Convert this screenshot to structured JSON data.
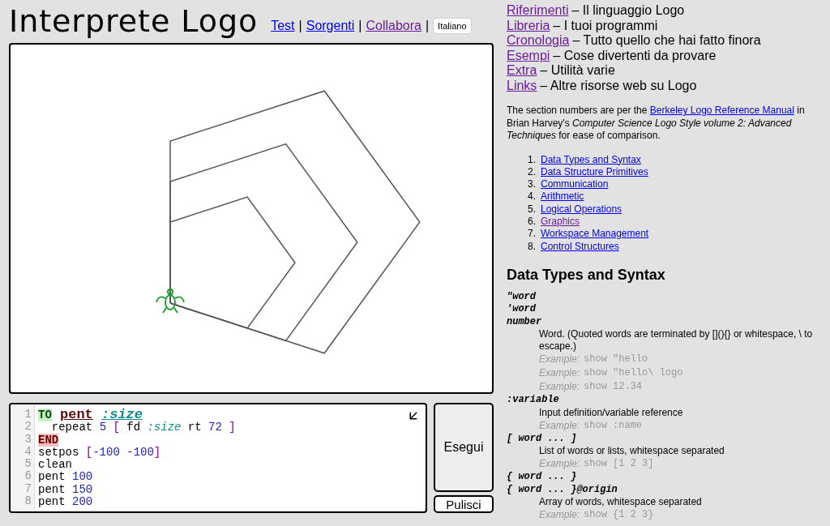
{
  "header": {
    "title": "Interprete Logo",
    "nav": [
      {
        "label": "Test",
        "visited": false,
        "separator": "|"
      },
      {
        "label": "Sorgenti",
        "visited": false,
        "separator": "|"
      },
      {
        "label": "Collabora",
        "visited": true,
        "separator": "|"
      }
    ],
    "language": "Italiano"
  },
  "editor": {
    "lines": [
      {
        "number": "1",
        "tokens": [
          {
            "text": "TO",
            "kind": "to"
          },
          {
            "text": "pent",
            "kind": "procname"
          },
          {
            "text": ":size",
            "kind": "param"
          }
        ]
      },
      {
        "number": "2",
        "tokens": [
          {
            "text": "  repeat ",
            "kind": "plain"
          },
          {
            "text": "5",
            "kind": "number"
          },
          {
            "text": " [",
            "kind": "bracket"
          },
          {
            "text": " fd ",
            "kind": "plain"
          },
          {
            "text": ":size",
            "kind": "var"
          },
          {
            "text": " rt ",
            "kind": "plain"
          },
          {
            "text": "72",
            "kind": "number"
          },
          {
            "text": " ]",
            "kind": "bracket"
          }
        ]
      },
      {
        "number": "3",
        "tokens": [
          {
            "text": "END",
            "kind": "end"
          }
        ]
      },
      {
        "number": "4",
        "tokens": [
          {
            "text": "setpos ",
            "kind": "plain"
          },
          {
            "text": "[",
            "kind": "bracket"
          },
          {
            "text": "-100 -100",
            "kind": "number"
          },
          {
            "text": "]",
            "kind": "bracket"
          }
        ]
      },
      {
        "number": "5",
        "tokens": [
          {
            "text": "clean",
            "kind": "plain"
          }
        ]
      },
      {
        "number": "6",
        "tokens": [
          {
            "text": "pent ",
            "kind": "plain"
          },
          {
            "text": "100",
            "kind": "number"
          }
        ]
      },
      {
        "number": "7",
        "tokens": [
          {
            "text": "pent ",
            "kind": "plain"
          },
          {
            "text": "150",
            "kind": "number"
          }
        ]
      },
      {
        "number": "8",
        "tokens": [
          {
            "text": "pent ",
            "kind": "plain"
          },
          {
            "text": "200",
            "kind": "number"
          }
        ]
      }
    ]
  },
  "buttons": {
    "run": "Esegui",
    "clear": "Pulisci"
  },
  "sidebar": {
    "menu": [
      {
        "link": "Riferimenti",
        "visited": true,
        "text": "– Il linguaggio Logo"
      },
      {
        "link": "Libreria",
        "visited": true,
        "text": "– I tuoi programmi"
      },
      {
        "link": "Cronologia",
        "visited": true,
        "text": "– Tutto quello che hai fatto finora"
      },
      {
        "link": "Esempi",
        "visited": true,
        "text": "– Cose divertenti da provare"
      },
      {
        "link": "Extra",
        "visited": true,
        "text": "– Utilità varie"
      },
      {
        "link": "Links",
        "visited": true,
        "text": "– Altre risorse web su Logo"
      }
    ],
    "intro": {
      "before": "The section numbers are per the",
      "link": "Berkeley Logo Reference Manual",
      "after": "in Brian Harvey's *Computer Science Logo Style volume 2: Advanced Techniques* for ease of comparison."
    },
    "sections": [
      {
        "number": "1.",
        "label": "Data Types and Syntax",
        "visited": false
      },
      {
        "number": "2.",
        "label": "Data Structure Primitives",
        "visited": false
      },
      {
        "number": "3.",
        "label": "Communication",
        "visited": false
      },
      {
        "number": "4.",
        "label": "Arithmetic",
        "visited": false
      },
      {
        "number": "5.",
        "label": "Logical Operations",
        "visited": false
      },
      {
        "number": "6.",
        "label": "Graphics",
        "visited": true
      },
      {
        "number": "7.",
        "label": "Workspace Management",
        "visited": false
      },
      {
        "number": "8.",
        "label": "Control Structures",
        "visited": false
      }
    ],
    "heading": "Data Types and Syntax",
    "entries": [
      {
        "kind": "term",
        "text": "\"word"
      },
      {
        "kind": "term",
        "text": "'word"
      },
      {
        "kind": "term",
        "text": "number"
      },
      {
        "kind": "desc",
        "text": "Word. (Quoted words are terminated by [](){} or whitespace, \\ to escape.)"
      },
      {
        "kind": "example",
        "label": "Example:",
        "code": "show \"hello"
      },
      {
        "kind": "example",
        "label": "Example:",
        "code": "show \"hello\\ logo"
      },
      {
        "kind": "example",
        "label": "Example:",
        "code": "show 12.34"
      },
      {
        "kind": "term",
        "text": ":variable"
      },
      {
        "kind": "desc",
        "text": "Input definition/variable reference"
      },
      {
        "kind": "example",
        "label": "Example:",
        "code": "show :name"
      },
      {
        "kind": "term",
        "text": "[ word ... ]"
      },
      {
        "kind": "desc",
        "text": "List of words or lists, whitespace separated"
      },
      {
        "kind": "example",
        "label": "Example:",
        "code": "show [1 2 3]"
      },
      {
        "kind": "term",
        "text": "{ word ... }"
      },
      {
        "kind": "term",
        "text": "{ word ... }@origin"
      },
      {
        "kind": "desc",
        "text": "Array of words, whitespace separated"
      },
      {
        "kind": "example",
        "label": "Example:",
        "code": "show {1 2 3}"
      }
    ]
  }
}
